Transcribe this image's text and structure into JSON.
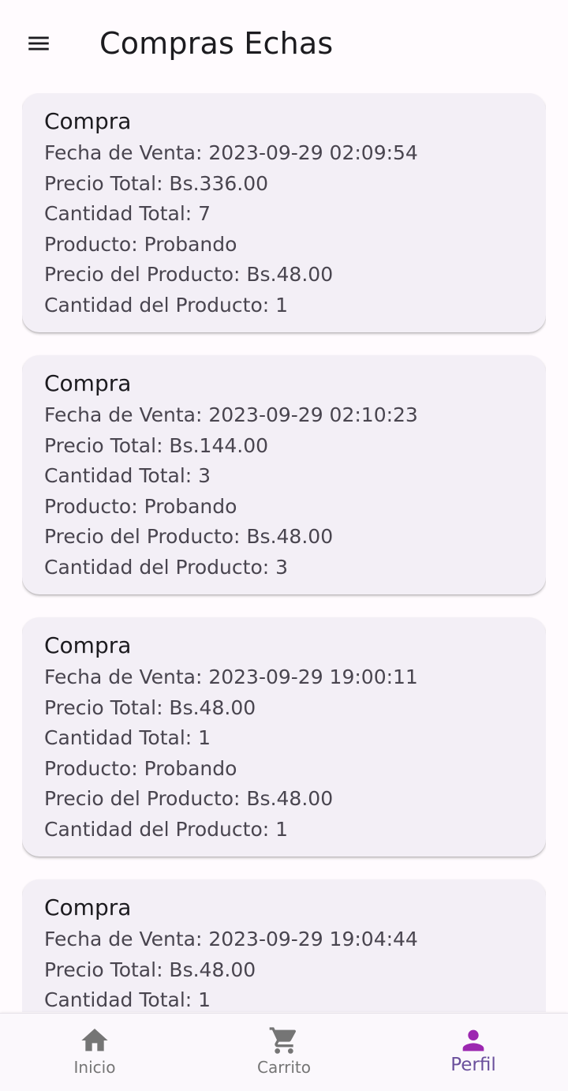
{
  "app_bar": {
    "title": "Compras Echas",
    "menu_icon": "menu-icon"
  },
  "purchases": [
    {
      "title": "Compra",
      "fecha": "Fecha de Venta: 2023-09-29 02:09:54",
      "precio_total": "Precio Total: Bs.336.00",
      "cantidad_total": "Cantidad Total: 7",
      "producto": "Producto: Probando",
      "precio_producto": "Precio del Producto: Bs.48.00",
      "cantidad_producto": "Cantidad del Producto: 1"
    },
    {
      "title": "Compra",
      "fecha": "Fecha de Venta: 2023-09-29 02:10:23",
      "precio_total": "Precio Total: Bs.144.00",
      "cantidad_total": "Cantidad Total: 3",
      "producto": "Producto: Probando",
      "precio_producto": "Precio del Producto: Bs.48.00",
      "cantidad_producto": "Cantidad del Producto: 3"
    },
    {
      "title": "Compra",
      "fecha": "Fecha de Venta: 2023-09-29 19:00:11",
      "precio_total": "Precio Total: Bs.48.00",
      "cantidad_total": "Cantidad Total: 1",
      "producto": "Producto: Probando",
      "precio_producto": "Precio del Producto: Bs.48.00",
      "cantidad_producto": "Cantidad del Producto: 1"
    },
    {
      "title": "Compra",
      "fecha": "Fecha de Venta: 2023-09-29 19:04:44",
      "precio_total": "Precio Total: Bs.48.00",
      "cantidad_total": "Cantidad Total: 1"
    }
  ],
  "bottom_nav": {
    "items": [
      {
        "label": "Inicio",
        "icon": "home-icon",
        "active": false
      },
      {
        "label": "Carrito",
        "icon": "cart-icon",
        "active": false
      },
      {
        "label": "Perfil",
        "icon": "person-icon",
        "active": true
      }
    ]
  },
  "colors": {
    "background": "#fffbfe",
    "card": "#f3eff6",
    "active_icon": "#9c27b0",
    "active_label": "#6a4f9c",
    "inactive": "#757575"
  }
}
